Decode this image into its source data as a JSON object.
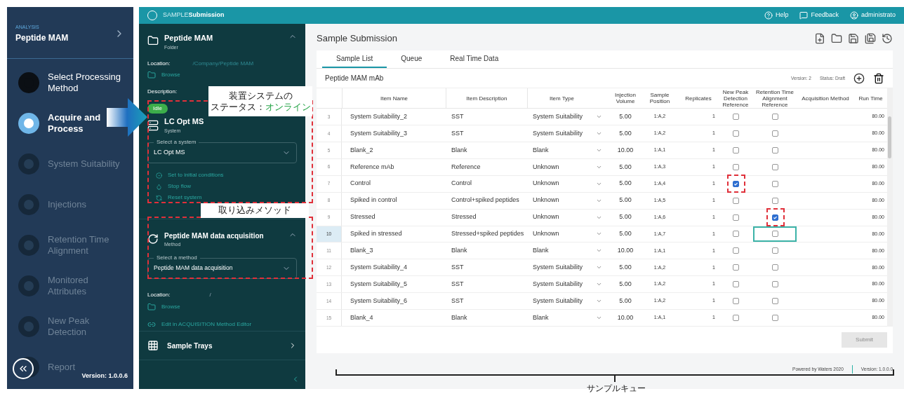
{
  "nav": {
    "section_label": "ANALYSIS",
    "title": "Peptide MAM",
    "steps": [
      {
        "label": "Select Processing Method",
        "done": true,
        "selected": false
      },
      {
        "label": "Acquire and Process",
        "done": false,
        "selected": true
      },
      {
        "label": "System Suitability",
        "done": false,
        "selected": false
      },
      {
        "label": "Injections",
        "done": false,
        "selected": false
      },
      {
        "label": "Retention Time Alignment",
        "done": false,
        "selected": false
      },
      {
        "label": "Monitored Attributes",
        "done": false,
        "selected": false
      },
      {
        "label": "New Peak Detection",
        "done": false,
        "selected": false
      },
      {
        "label": "Report",
        "done": false,
        "selected": false
      }
    ],
    "version": "Version: 1.0.0.6"
  },
  "app": {
    "brand_light": "SAMPLE",
    "brand_bold": "Submission",
    "header_links": [
      "Help",
      "Feedback",
      "administrato"
    ]
  },
  "panel": {
    "folder": {
      "name": "Peptide MAM",
      "sub": "Folder",
      "location_label": "Location:",
      "location": "/Company/Peptide MAM",
      "browse": "Browse",
      "description_label": "Description:"
    },
    "system": {
      "badge": "Idle",
      "name": "LC Opt MS",
      "sub": "System",
      "select_label": "Select a system",
      "select_value": "LC Opt MS",
      "actions": [
        "Set to initial conditions",
        "Stop flow",
        "Reset system"
      ]
    },
    "method": {
      "name": "Peptide MAM data acquisition",
      "sub": "Method",
      "select_label": "Select a method",
      "select_value": "Peptide MAM data acquisition",
      "location_label": "Location:",
      "location": "/",
      "browse": "Browse",
      "edit": "Edit in ACQUISITION Method Editor"
    },
    "trays": "Sample Trays"
  },
  "main": {
    "title": "Sample Submission",
    "tabs": [
      {
        "label": "Sample List",
        "selected": true
      },
      {
        "label": "Queue",
        "selected": false
      },
      {
        "label": "Real Time Data",
        "selected": false
      }
    ],
    "list_name": "Peptide MAM mAb",
    "version": "Version: 2",
    "status": "Status: Draft",
    "columns": [
      "Item Name",
      "Item Description",
      "Item Type",
      "Injection Volume",
      "Sample Position",
      "Replicates",
      "New Peak Detection Reference",
      "Retention Time Alignment Reference",
      "Acquisition Method",
      "Run Time"
    ],
    "rows": [
      {
        "n": "3",
        "name": "System Suitability_2",
        "desc": "SST",
        "type": "System Suitability",
        "vol": "5.00",
        "pos": "1:A,2",
        "rep": "1",
        "np": false,
        "rt": false,
        "run": "80.00",
        "selected": false,
        "np_flagged": false,
        "rt_flagged": false
      },
      {
        "n": "4",
        "name": "System Suitability_3",
        "desc": "SST",
        "type": "System Suitability",
        "vol": "5.00",
        "pos": "1:A,2",
        "rep": "1",
        "np": false,
        "rt": false,
        "run": "80.00",
        "selected": false,
        "np_flagged": false,
        "rt_flagged": false
      },
      {
        "n": "5",
        "name": "Blank_2",
        "desc": "Blank",
        "type": "Blank",
        "vol": "10.00",
        "pos": "1:A,1",
        "rep": "1",
        "np": false,
        "rt": false,
        "run": "80.00",
        "selected": false,
        "np_flagged": false,
        "rt_flagged": false
      },
      {
        "n": "6",
        "name": "Reference mAb",
        "desc": "Reference",
        "type": "Unknown",
        "vol": "5.00",
        "pos": "1:A,3",
        "rep": "1",
        "np": false,
        "rt": false,
        "run": "80.00",
        "selected": false,
        "np_flagged": false,
        "rt_flagged": false
      },
      {
        "n": "7",
        "name": "Control",
        "desc": "Control",
        "type": "Unknown",
        "vol": "5.00",
        "pos": "1:A,4",
        "rep": "1",
        "np": true,
        "rt": false,
        "run": "80.00",
        "selected": false,
        "np_flagged": true,
        "rt_flagged": false
      },
      {
        "n": "8",
        "name": "Spiked in control",
        "desc": "Control+spiked peptides",
        "type": "Unknown",
        "vol": "5.00",
        "pos": "1:A,5",
        "rep": "1",
        "np": false,
        "rt": false,
        "run": "80.00",
        "selected": false,
        "np_flagged": false,
        "rt_flagged": false
      },
      {
        "n": "9",
        "name": "Stressed",
        "desc": "Stressed",
        "type": "Unknown",
        "vol": "5.00",
        "pos": "1:A,6",
        "rep": "1",
        "np": false,
        "rt": true,
        "run": "80.00",
        "selected": false,
        "np_flagged": false,
        "rt_flagged": true
      },
      {
        "n": "10",
        "name": "Spiked in stressed",
        "desc": "Stressed+spiked peptides",
        "type": "Unknown",
        "vol": "5.00",
        "pos": "1:A,7",
        "rep": "1",
        "np": false,
        "rt": false,
        "run": "80.00",
        "selected": true,
        "np_flagged": false,
        "rt_flagged": false
      },
      {
        "n": "11",
        "name": "Blank_3",
        "desc": "Blank",
        "type": "Blank",
        "vol": "10.00",
        "pos": "1:A,1",
        "rep": "1",
        "np": false,
        "rt": false,
        "run": "80.00",
        "selected": false,
        "np_flagged": false,
        "rt_flagged": false
      },
      {
        "n": "12",
        "name": "System Suitability_4",
        "desc": "SST",
        "type": "System Suitability",
        "vol": "5.00",
        "pos": "1:A,2",
        "rep": "1",
        "np": false,
        "rt": false,
        "run": "80.00",
        "selected": false,
        "np_flagged": false,
        "rt_flagged": false
      },
      {
        "n": "13",
        "name": "System Suitability_5",
        "desc": "SST",
        "type": "System Suitability",
        "vol": "5.00",
        "pos": "1:A,2",
        "rep": "1",
        "np": false,
        "rt": false,
        "run": "80.00",
        "selected": false,
        "np_flagged": false,
        "rt_flagged": false
      },
      {
        "n": "14",
        "name": "System Suitability_6",
        "desc": "SST",
        "type": "System Suitability",
        "vol": "5.00",
        "pos": "1:A,2",
        "rep": "1",
        "np": false,
        "rt": false,
        "run": "80.00",
        "selected": false,
        "np_flagged": false,
        "rt_flagged": false
      },
      {
        "n": "15",
        "name": "Blank_4",
        "desc": "Blank",
        "type": "Blank",
        "vol": "10.00",
        "pos": "1:A,1",
        "rep": "1",
        "np": false,
        "rt": false,
        "run": "80.00",
        "selected": false,
        "np_flagged": false,
        "rt_flagged": false
      }
    ],
    "submit": "Submit",
    "footer": "Powered by Waters 2020",
    "footer_version": "Version: 1.0.0.0"
  },
  "annotations": {
    "system_callout": {
      "line1": "装置システムの",
      "line2_label": "ステータス：",
      "line2_status": "オンライン"
    },
    "method_callout": "取り込みメソッド",
    "queue_label": "サンプルキュー"
  }
}
